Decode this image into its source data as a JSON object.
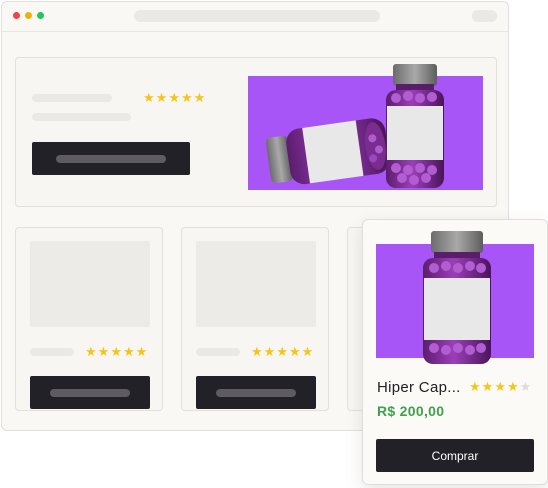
{
  "hero": {
    "rating": 5
  },
  "cards": [
    {
      "rating": 5
    },
    {
      "rating": 5
    }
  ],
  "popup": {
    "product_name": "Hiper Cap...",
    "rating": 4,
    "price": "R$ 200,00",
    "buy_label": "Comprar"
  },
  "colors": {
    "accent": "#a855f7",
    "button": "#232128",
    "price": "#3fa14d",
    "star": "#f5c518"
  }
}
